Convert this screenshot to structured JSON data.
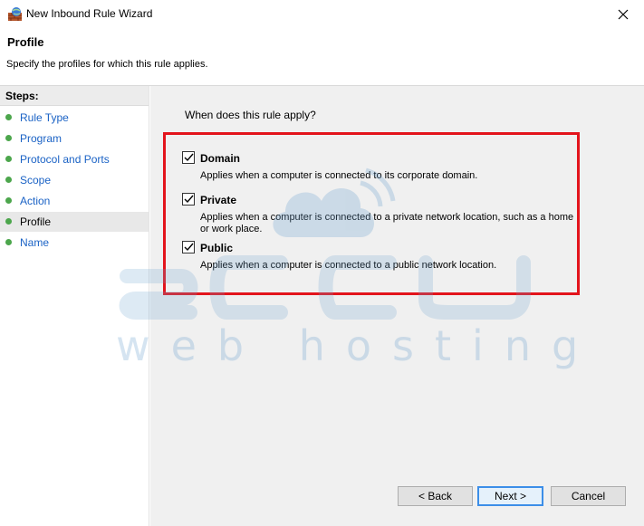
{
  "window": {
    "title": "New Inbound Rule Wizard",
    "icon": "firewall-wizard-icon",
    "close_icon": "close-icon"
  },
  "header": {
    "title": "Profile",
    "subtitle": "Specify the profiles for which this rule applies."
  },
  "steps": {
    "header": "Steps:",
    "items": [
      {
        "label": "Rule Type",
        "active": false
      },
      {
        "label": "Program",
        "active": false
      },
      {
        "label": "Protocol and Ports",
        "active": false
      },
      {
        "label": "Scope",
        "active": false
      },
      {
        "label": "Action",
        "active": false
      },
      {
        "label": "Profile",
        "active": true
      },
      {
        "label": "Name",
        "active": false
      }
    ]
  },
  "main": {
    "question": "When does this rule apply?",
    "options": [
      {
        "label": "Domain",
        "checked": true,
        "description": "Applies when a computer is connected to its corporate domain."
      },
      {
        "label": "Private",
        "checked": true,
        "description_line1": "Applies when a computer is connected to a private network location, such as a home",
        "description_line2": "or work place."
      },
      {
        "label": "Public",
        "checked": true,
        "description": "Applies when a computer is connected to a public network location."
      }
    ]
  },
  "buttons": {
    "back": "< Back",
    "next": "Next >",
    "cancel": "Cancel"
  },
  "watermark": {
    "logo_text": "accu",
    "tagline": "web hosting"
  },
  "colors": {
    "highlight_border": "#e3141c",
    "step_dot": "#4ca64c",
    "link": "#1a62c5",
    "default_button_border": "#3c8ee8"
  }
}
